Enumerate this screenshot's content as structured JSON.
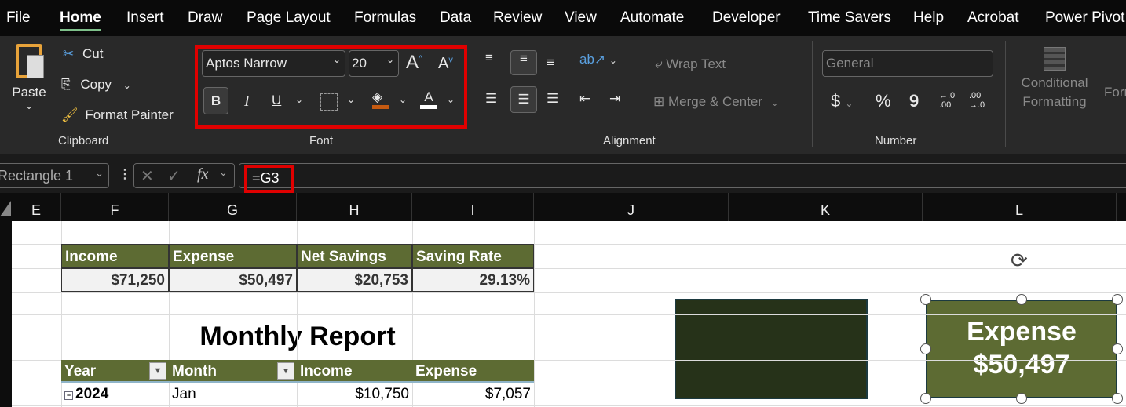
{
  "tabs": [
    "File",
    "Home",
    "Insert",
    "Draw",
    "Page Layout",
    "Formulas",
    "Data",
    "Review",
    "View",
    "Automate",
    "Developer",
    "Time Savers",
    "Help",
    "Acrobat",
    "Power Pivot"
  ],
  "active_tab": "Home",
  "clipboard": {
    "paste": "Paste",
    "cut": "Cut",
    "copy": "Copy",
    "format_painter": "Format Painter",
    "label": "Clipboard"
  },
  "font": {
    "name": "Aptos Narrow",
    "size": "20",
    "bold": "B",
    "italic": "I",
    "underline": "U",
    "font_color_glyph": "A",
    "label": "Font",
    "fill_color": "#c55a11",
    "font_color": "#ffffff"
  },
  "alignment": {
    "wrap_text": "Wrap Text",
    "merge_center": "Merge & Center",
    "label": "Alignment"
  },
  "number": {
    "format": "General",
    "currency": "$",
    "percent": "%",
    "comma": "9",
    "label": "Number",
    "inc_decimal": "←.0 .00",
    "dec_decimal": ".00 →.0"
  },
  "styles": {
    "conditional_formatting": "Conditional Formatting",
    "format_table": "Format as Table"
  },
  "formula_bar": {
    "name_box": "Rectangle 1",
    "fx": "fx",
    "formula": "=G3"
  },
  "columns": [
    "E",
    "F",
    "G",
    "H",
    "I",
    "J",
    "K",
    "L"
  ],
  "summary": {
    "headers": [
      "Income",
      "Expense",
      "Net Savings",
      "Saving Rate"
    ],
    "values": [
      "$71,250",
      "$50,497",
      "$20,753",
      "29.13%"
    ]
  },
  "report": {
    "title": "Monthly Report",
    "headers": [
      "Year",
      "Month",
      "Income",
      "Expense"
    ],
    "rows": [
      {
        "year": "2024",
        "month": "Jan",
        "income": "$10,750",
        "expense": "$7,057"
      }
    ]
  },
  "shape": {
    "label": "Expense",
    "value": "$50,497",
    "fill": "#5d6b33"
  },
  "dark_shape_fill": "#263219",
  "accent_highlight": "#e00000"
}
